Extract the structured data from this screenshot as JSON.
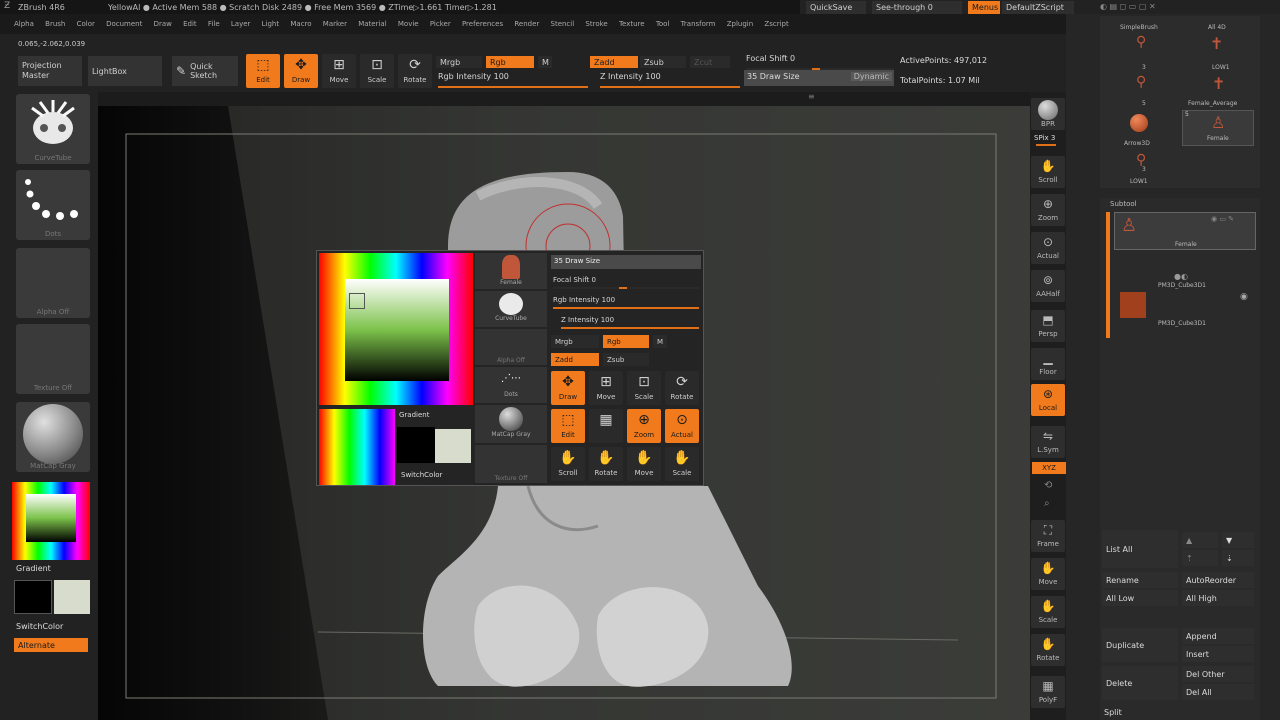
{
  "title_bar": {
    "app": "ZBrush 4R6",
    "status": "YellowAl  ● Active Mem 588 ● Scratch Disk 2489 ● Free Mem 3569 ● ZTime▷1.661 Timer▷1.281",
    "quicksave": "QuickSave",
    "see_through": "See-through  0",
    "menus": "Menus",
    "default_script": "DefaultZScript"
  },
  "menu_bar": {
    "items": [
      "Alpha",
      "Brush",
      "Color",
      "Document",
      "Draw",
      "Edit",
      "File",
      "Layer",
      "Light",
      "Macro",
      "Marker",
      "Material",
      "Movie",
      "Picker",
      "Preferences",
      "Render",
      "Stencil",
      "Stroke",
      "Texture",
      "Tool",
      "Transform",
      "Zplugin",
      "Zscript"
    ]
  },
  "coords": "0.065,-2.062,0.039",
  "top_shelf": {
    "projection_master": "Projection Master",
    "lightbox": "LightBox",
    "quick_sketch": "Quick Sketch",
    "edit": "Edit",
    "draw": "Draw",
    "move": "Move",
    "scale": "Scale",
    "rotate": "Rotate",
    "mrgb": "Mrgb",
    "rgb": "Rgb",
    "m": "M",
    "rgb_intensity": "Rgb Intensity 100",
    "zadd": "Zadd",
    "zsub": "Zsub",
    "zcut": "Zcut",
    "z_intensity": "Z Intensity 100",
    "focal_shift": "Focal Shift 0",
    "draw_size": "35 Draw Size",
    "dynamic": "Dynamic",
    "active_points": "ActivePoints: 497,012",
    "total_points": "TotalPoints: 1.07 Mil"
  },
  "left_tray": {
    "brush_caption": "CurveTube",
    "stroke_caption": "Dots",
    "alpha_caption": "Alpha Off",
    "texture_caption": "Texture Off",
    "material_caption": "MatCap Gray",
    "gradient": "Gradient",
    "switch_color": "SwitchColor",
    "alternate": "Alternate"
  },
  "popup": {
    "draw_size": "35 Draw Size",
    "focal_shift": "Focal Shift 0",
    "rgb_intensity": "Rgb Intensity 100",
    "z_intensity": "Z Intensity 100",
    "mrgb": "Mrgb",
    "rgb": "Rgb",
    "m": "M",
    "zadd": "Zadd",
    "zsub": "Zsub",
    "tile_female": "Female",
    "tile_curvetube": "CurveTube",
    "tile_alpha": "Alpha Off",
    "tile_dots": "Dots",
    "tile_matcap": "MatCap Gray",
    "tile_texture": "Texture Off",
    "gradient": "Gradient",
    "switch_color": "SwitchColor",
    "draw": "Draw",
    "move": "Move",
    "scale": "Scale",
    "rotate": "Rotate",
    "edit": "Edit",
    "zoom": "Zoom",
    "actual": "Actual",
    "scroll": "Scroll",
    "rotate2": "Rotate",
    "move2": "Move",
    "scale2": "Scale"
  },
  "right_shelf": {
    "bpr": "BPR",
    "spix": "SPix 3",
    "scroll": "Scroll",
    "zoom": "Zoom",
    "actual": "Actual",
    "aahalf": "AAHalf",
    "persp": "Persp",
    "floor": "Floor",
    "local": "Local",
    "lsym": "L.Sym",
    "xyz": "XYZ",
    "frame": "Frame",
    "move": "Move",
    "scale": "Scale",
    "rotate": "Rotate",
    "polyf": "PolyF"
  },
  "tool_palette": {
    "simplebrush": "SimpleBrush",
    "all3d": "All 4D",
    "low1": "LOW1",
    "female_average": "Female_Average",
    "arrow3d": "Arrow3D",
    "female": "Female",
    "low1b": "LOW1",
    "num3": "3",
    "num5a": "5",
    "num5b": "5",
    "num3b": "3"
  },
  "subtool": {
    "header": "Subtool",
    "item1": "Female",
    "item2": "PM3D_Cube3D1",
    "item3": "PM3D_Cube3D1",
    "list_all": "List All",
    "rename": "Rename",
    "autoreorder": "AutoReorder",
    "all_low": "All Low",
    "all_high": "All High",
    "duplicate": "Duplicate",
    "append": "Append",
    "insert": "Insert",
    "delete": "Delete",
    "del_other": "Del Other",
    "del_all": "Del All",
    "split": "Split"
  },
  "colors": {
    "accent": "#f07a1c",
    "bg": "#1c1c1c",
    "panel": "#2b2b2b"
  }
}
